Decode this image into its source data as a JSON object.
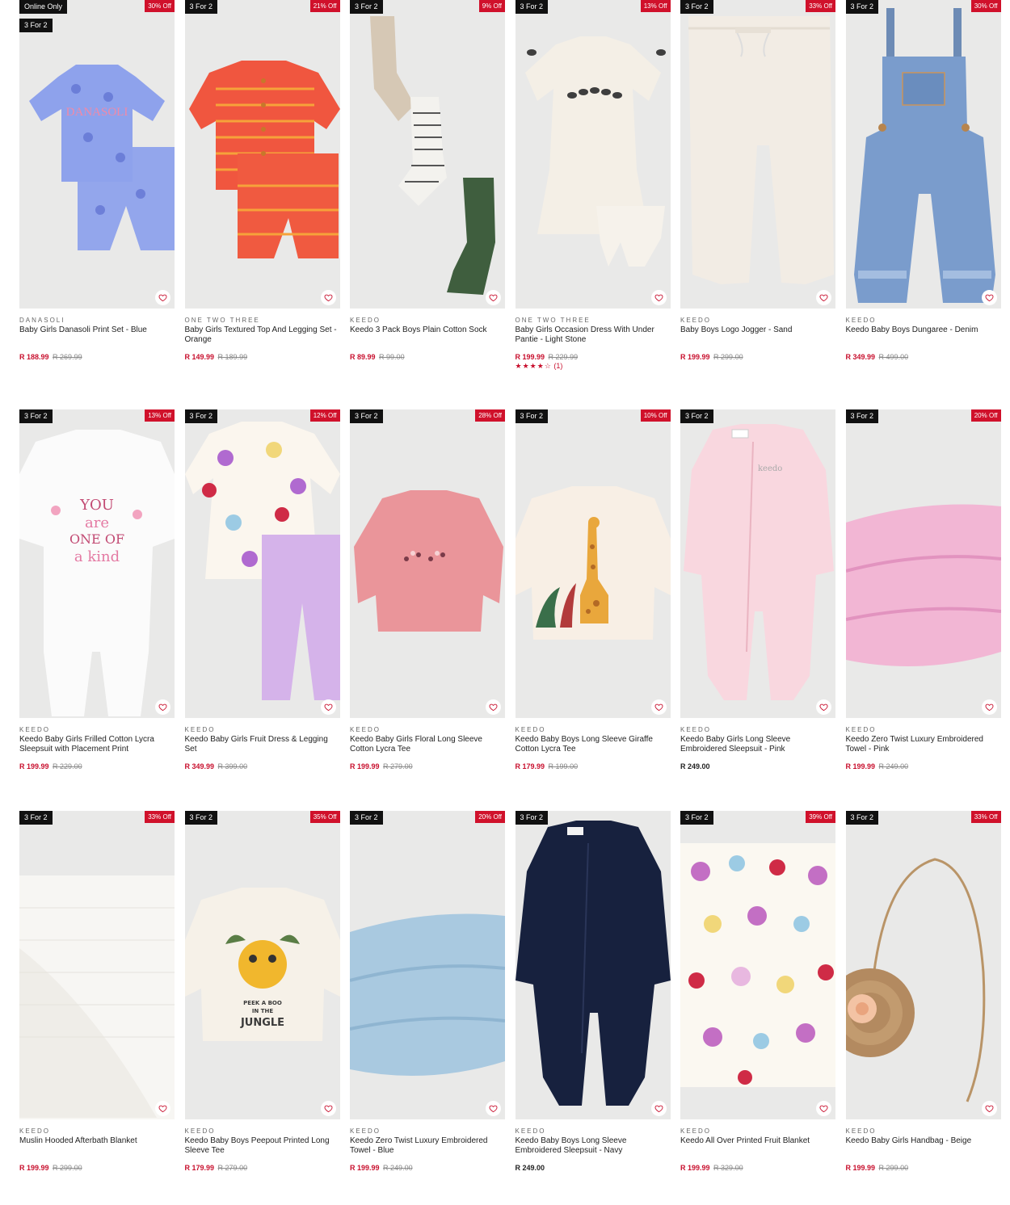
{
  "colors": {
    "accent": "#c8102e",
    "badge_bg": "#111111",
    "discount_bg": "#d0112b",
    "image_bg": "#e9e9e8"
  },
  "products": [
    {
      "badge_online": "Online Only",
      "badge_promo": "3 For 2",
      "discount": "30% Off",
      "brand": "DANASOLI",
      "name": "Baby Girls Danasoli Print Set - Blue",
      "price": "R 188.99",
      "was": "R 269.99",
      "illustration": "blue-print-set"
    },
    {
      "badge_promo": "3 For 2",
      "discount": "21% Off",
      "brand": "ONE TWO THREE",
      "name": "Baby Girls Textured Top And Legging Set - Orange",
      "price": "R 149.99",
      "was": "R 189.99",
      "illustration": "orange-set"
    },
    {
      "badge_promo": "3 For 2",
      "discount": "9% Off",
      "brand": "KEEDO",
      "name": "Keedo 3 Pack Boys Plain Cotton Sock",
      "price": "R 89.99",
      "was": "R 99.00",
      "illustration": "socks"
    },
    {
      "badge_promo": "3 For 2",
      "discount": "13% Off",
      "brand": "ONE TWO THREE",
      "name": "Baby Girls Occasion Dress With Under Pantie - Light Stone",
      "price": "R 199.99",
      "was": "R 229.99",
      "rating_stars": "★★★★☆",
      "rating_count": "(1)",
      "illustration": "dress"
    },
    {
      "badge_promo": "3 For 2",
      "discount": "33% Off",
      "brand": "KEEDO",
      "name": "Baby Boys Logo Jogger - Sand",
      "price": "R 199.99",
      "was": "R 299.00",
      "illustration": "jogger"
    },
    {
      "badge_promo": "3 For 2",
      "discount": "30% Off",
      "brand": "KEEDO",
      "name": "Keedo Baby Boys Dungaree - Denim",
      "price": "R 349.99",
      "was": "R 499.00",
      "illustration": "dungaree"
    },
    {
      "badge_promo": "3 For 2",
      "discount": "13% Off",
      "brand": "KEEDO",
      "name": "Keedo Baby Girls Frilled Cotton Lycra Sleepsuit with Placement Print",
      "price": "R 199.99",
      "was": "R 229.00",
      "illustration": "white-sleepsuit"
    },
    {
      "badge_promo": "3 For 2",
      "discount": "12% Off",
      "brand": "KEEDO",
      "name": "Keedo Baby Girls Fruit Dress & Legging Set",
      "price": "R 349.99",
      "was": "R 399.00",
      "illustration": "fruit-dress"
    },
    {
      "badge_promo": "3 For 2",
      "discount": "28% Off",
      "brand": "KEEDO",
      "name": "Keedo Baby Girls Floral Long Sleeve Cotton Lycra Tee",
      "price": "R 199.99",
      "was": "R 279.00",
      "illustration": "pink-tee"
    },
    {
      "badge_promo": "3 For 2",
      "discount": "10% Off",
      "brand": "KEEDO",
      "name": "Keedo Baby Boys Long Sleeve Giraffe Cotton Lycra Tee",
      "price": "R 179.99",
      "was": "R 199.00",
      "illustration": "giraffe-tee"
    },
    {
      "badge_promo": "3 For 2",
      "brand": "KEEDO",
      "name": "Keedo Baby Girls Long Sleeve Embroidered Sleepsuit - Pink",
      "price": "R 249.00",
      "regular": true,
      "illustration": "pink-sleepsuit"
    },
    {
      "badge_promo": "3 For 2",
      "discount": "20% Off",
      "brand": "KEEDO",
      "name": "Keedo Zero Twist Luxury Embroidered Towel - Pink",
      "price": "R 199.99",
      "was": "R 249.00",
      "illustration": "pink-towel"
    },
    {
      "badge_promo": "3 For 2",
      "discount": "33% Off",
      "brand": "KEEDO",
      "name": "Muslin Hooded Afterbath Blanket",
      "price": "R 199.99",
      "was": "R 299.00",
      "illustration": "muslin"
    },
    {
      "badge_promo": "3 For 2",
      "discount": "35% Off",
      "brand": "KEEDO",
      "name": "Keedo Baby Boys Peepout Printed Long Sleeve Tee",
      "price": "R 179.99",
      "was": "R 279.00",
      "illustration": "jungle-tee",
      "print_text": "PEEK A BOO IN THE JUNGLE"
    },
    {
      "badge_promo": "3 For 2",
      "discount": "20% Off",
      "brand": "KEEDO",
      "name": "Keedo Zero Twist Luxury Embroidered Towel - Blue",
      "price": "R 199.99",
      "was": "R 249.00",
      "illustration": "blue-towel"
    },
    {
      "badge_promo": "3 For 2",
      "brand": "KEEDO",
      "name": "Keedo Baby Boys Long Sleeve Embroidered Sleepsuit - Navy",
      "price": "R 249.00",
      "regular": true,
      "illustration": "navy-sleepsuit"
    },
    {
      "badge_promo": "3 For 2",
      "discount": "39% Off",
      "brand": "KEEDO",
      "name": "Keedo All Over Printed Fruit Blanket",
      "price": "R 199.99",
      "was": "R 329.00",
      "illustration": "fruit-blanket"
    },
    {
      "badge_promo": "3 For 2",
      "discount": "33% Off",
      "brand": "KEEDO",
      "name": "Keedo Baby Girls Handbag - Beige",
      "price": "R 199.99",
      "was": "R 299.00",
      "illustration": "handbag"
    }
  ]
}
